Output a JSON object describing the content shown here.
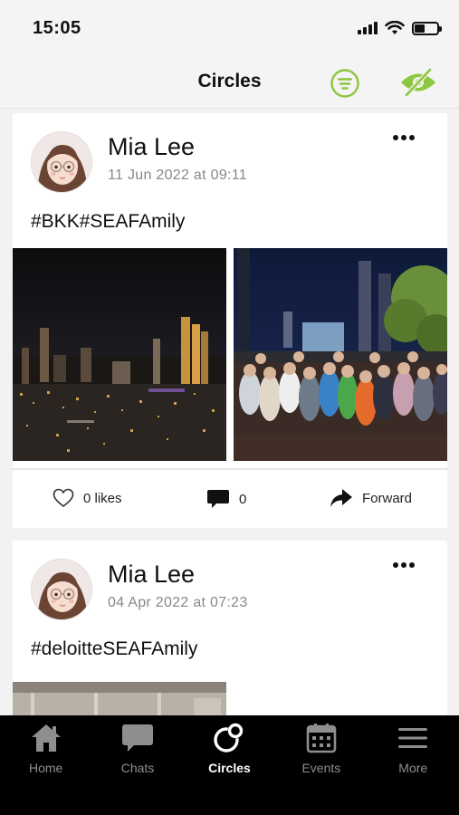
{
  "status_bar": {
    "time": "15:05"
  },
  "header": {
    "title": "Circles"
  },
  "colors": {
    "accent": "#8dc63f",
    "tab_bar_bg": "#000000",
    "tab_inactive": "#8e8e8e"
  },
  "posts": [
    {
      "author": "Mia Lee",
      "date": "11 Jun 2022 at 09:11",
      "text": "#BKK#SEAFAmily",
      "likes": "0 likes",
      "comments": "0",
      "forward_label": "Forward"
    },
    {
      "author": "Mia Lee",
      "date": "04 Apr 2022 at 07:23",
      "text": "#deloitteSEAFAmily"
    }
  ],
  "tabs": [
    {
      "label": "Home",
      "icon": "home-icon"
    },
    {
      "label": "Chats",
      "icon": "chat-icon"
    },
    {
      "label": "Circles",
      "icon": "circles-icon",
      "active": true
    },
    {
      "label": "Events",
      "icon": "calendar-icon"
    },
    {
      "label": "More",
      "icon": "menu-icon"
    }
  ]
}
